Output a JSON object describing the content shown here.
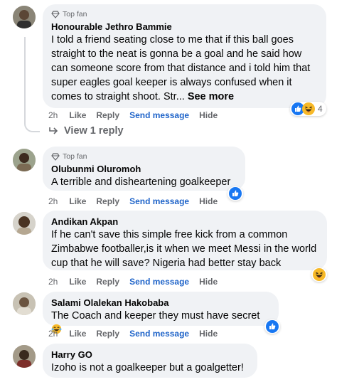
{
  "comments": [
    {
      "badge": "Top fan",
      "author": "Honourable Jethro Bammie",
      "text": "I told a friend seating close to me that if this ball goes straight to the neat is gonna be a goal and he said how can someone score from that distance and i told him that super eagles goal keeper is always confused when it comes to straight shoot. Str...",
      "see_more": "See more",
      "time": "2h",
      "like": "Like",
      "reply": "Reply",
      "send": "Send message",
      "hide": "Hide",
      "reaction_count": "4",
      "reactions": [
        "like-icon",
        "haha-icon"
      ]
    },
    {
      "badge": "Top fan",
      "author": "Olubunmi Oluromoh",
      "text": "A terrible and disheartening goalkeeper",
      "time": "2h",
      "like": "Like",
      "reply": "Reply",
      "send": "Send message",
      "hide": "Hide",
      "reactions": [
        "like-icon"
      ]
    },
    {
      "author": "Andikan Akpan",
      "text": "If he can't save this simple free kick from a common Zimbabwe footballer,is it when we meet Messi in the world cup that he will save? Nigeria had better stay back",
      "time": "2h",
      "like": "Like",
      "reply": "Reply",
      "send": "Send message",
      "hide": "Hide",
      "reactions": [
        "haha-icon"
      ]
    },
    {
      "author": "Salami Olalekan Hakobaba",
      "text": "The Coach and keeper they must have secret",
      "text_emoji": "laughing-tears-emoji",
      "time": "2h",
      "like": "Like",
      "reply": "Reply",
      "send": "Send message",
      "hide": "Hide",
      "reactions": [
        "like-icon"
      ]
    },
    {
      "author": "Harry GO",
      "text": "Izoho is not a goalkeeper but a goalgetter!"
    }
  ],
  "view_replies": "View 1 reply",
  "colors": {
    "bubble": "#f0f2f5",
    "meta": "#65676b",
    "link": "#1f64c9",
    "like_blue": "#1877f2",
    "haha_yellow": "#f7b928"
  }
}
